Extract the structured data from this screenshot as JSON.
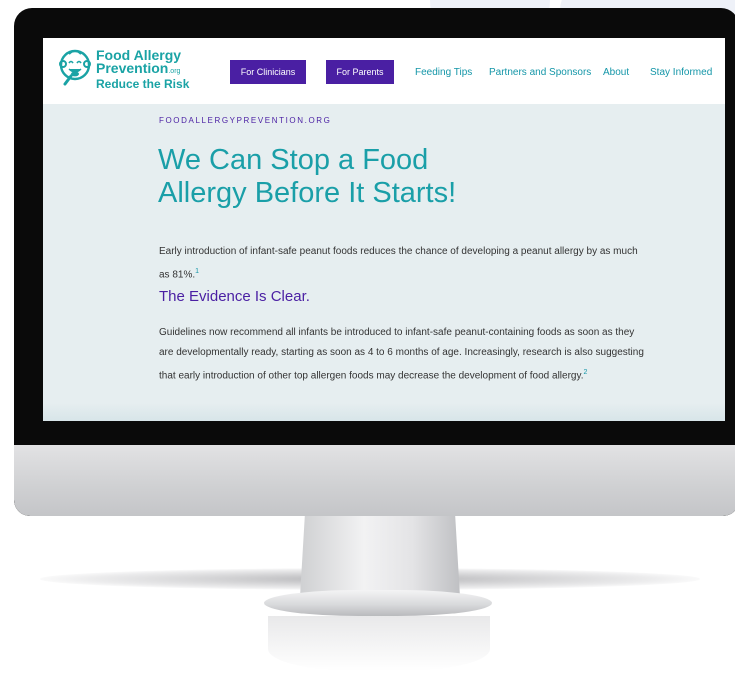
{
  "header": {
    "logo": {
      "line1": "Food Allergy",
      "line2": "Prevention",
      "domain_suffix": ".org",
      "line3": "Reduce the Risk"
    },
    "buttons": [
      {
        "label": "For Clinicians"
      },
      {
        "label": "For Parents"
      }
    ],
    "links": [
      {
        "label": "Feeding Tips"
      },
      {
        "label": "Partners and Sponsors"
      },
      {
        "label": "About"
      },
      {
        "label": "Stay Informed"
      }
    ]
  },
  "hero": {
    "eyebrow": "FOODALLERGYPREVENTION.ORG",
    "headline_line1": "We Can Stop a Food",
    "headline_line2": "Allergy Before It Starts!"
  },
  "body": {
    "intro": "Early introduction of infant-safe peanut foods reduces the chance of developing a peanut allergy by as much as 81%.",
    "intro_ref": "1",
    "subhead": "The Evidence Is Clear.",
    "evidence": "Guidelines now recommend all infants be introduced to infant-safe peanut-containing foods as soon as they are developmentally ready, starting as soon as 4 to 6 months of age. Increasingly, research is also suggesting that early introduction of other top allergen foods may decrease the development of food allergy.",
    "evidence_ref": "2"
  },
  "colors": {
    "brand_teal": "#1aa3a5",
    "brand_purple": "#4a1fa3",
    "page_background": "#e6eef0"
  }
}
